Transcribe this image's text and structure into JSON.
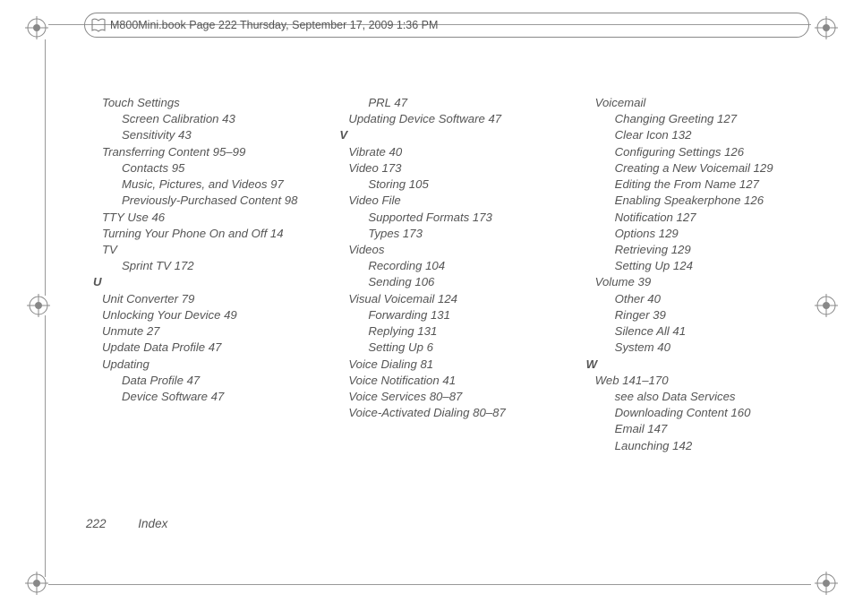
{
  "header": {
    "text": "M800Mini.book  Page 222  Thursday, September 17, 2009  1:36 PM"
  },
  "footer": {
    "page": "222",
    "label": "Index"
  },
  "columns": [
    [
      {
        "lvl": 0,
        "t": "Touch Settings"
      },
      {
        "lvl": 1,
        "t": "Screen Calibration 43"
      },
      {
        "lvl": 1,
        "t": "Sensitivity 43"
      },
      {
        "lvl": 0,
        "t": "Transferring Content 95–99"
      },
      {
        "lvl": 1,
        "t": "Contacts 95"
      },
      {
        "lvl": 1,
        "t": "Music, Pictures, and Videos 97"
      },
      {
        "lvl": 1,
        "t": "Previously-Purchased Content 98"
      },
      {
        "lvl": 0,
        "t": "TTY Use 46"
      },
      {
        "lvl": 0,
        "t": "Turning Your Phone On and Off 14"
      },
      {
        "lvl": 0,
        "t": "TV"
      },
      {
        "lvl": 1,
        "t": "Sprint TV 172"
      },
      {
        "lvl": "L",
        "t": "U"
      },
      {
        "lvl": 0,
        "t": "Unit Converter 79"
      },
      {
        "lvl": 0,
        "t": "Unlocking Your Device 49"
      },
      {
        "lvl": 0,
        "t": "Unmute 27"
      },
      {
        "lvl": 0,
        "t": "Update Data Profile 47"
      },
      {
        "lvl": 0,
        "t": "Updating"
      },
      {
        "lvl": 1,
        "t": "Data Profile 47"
      },
      {
        "lvl": 1,
        "t": "Device Software 47"
      }
    ],
    [
      {
        "lvl": 1,
        "t": "PRL 47"
      },
      {
        "lvl": 0,
        "t": "Updating Device Software 47"
      },
      {
        "lvl": "L",
        "t": "V"
      },
      {
        "lvl": 0,
        "t": "Vibrate 40"
      },
      {
        "lvl": 0,
        "t": "Video 173"
      },
      {
        "lvl": 1,
        "t": "Storing 105"
      },
      {
        "lvl": 0,
        "t": "Video File"
      },
      {
        "lvl": 1,
        "t": "Supported Formats 173"
      },
      {
        "lvl": 1,
        "t": "Types 173"
      },
      {
        "lvl": 0,
        "t": "Videos"
      },
      {
        "lvl": 1,
        "t": "Recording 104"
      },
      {
        "lvl": 1,
        "t": "Sending 106"
      },
      {
        "lvl": 0,
        "t": "Visual Voicemail 124"
      },
      {
        "lvl": 1,
        "t": "Forwarding 131"
      },
      {
        "lvl": 1,
        "t": "Replying 131"
      },
      {
        "lvl": 1,
        "t": "Setting Up 6"
      },
      {
        "lvl": 0,
        "t": "Voice Dialing 81"
      },
      {
        "lvl": 0,
        "t": "Voice Notification 41"
      },
      {
        "lvl": 0,
        "t": "Voice Services 80–87"
      },
      {
        "lvl": 0,
        "t": "Voice-Activated Dialing 80–87"
      }
    ],
    [
      {
        "lvl": 0,
        "t": "Voicemail"
      },
      {
        "lvl": 1,
        "t": "Changing Greeting 127"
      },
      {
        "lvl": 1,
        "t": "Clear Icon 132"
      },
      {
        "lvl": 1,
        "t": "Configuring Settings 126"
      },
      {
        "lvl": 1,
        "t": "Creating a New Voicemail 129"
      },
      {
        "lvl": 1,
        "t": "Editing the From Name 127"
      },
      {
        "lvl": 1,
        "t": "Enabling Speakerphone 126"
      },
      {
        "lvl": 1,
        "t": "Notification 127"
      },
      {
        "lvl": 1,
        "t": "Options 129"
      },
      {
        "lvl": 1,
        "t": "Retrieving 129"
      },
      {
        "lvl": 1,
        "t": "Setting Up 124"
      },
      {
        "lvl": 0,
        "t": "Volume 39"
      },
      {
        "lvl": 1,
        "t": "Other 40"
      },
      {
        "lvl": 1,
        "t": "Ringer 39"
      },
      {
        "lvl": 1,
        "t": "Silence All 41"
      },
      {
        "lvl": 1,
        "t": "System 40"
      },
      {
        "lvl": "L",
        "t": "W"
      },
      {
        "lvl": 0,
        "t": "Web 141–170"
      },
      {
        "lvl": 1,
        "t": "see also Data Services"
      },
      {
        "lvl": 1,
        "t": "Downloading Content 160"
      },
      {
        "lvl": 1,
        "t": "Email 147"
      },
      {
        "lvl": 1,
        "t": "Launching 142"
      }
    ]
  ]
}
